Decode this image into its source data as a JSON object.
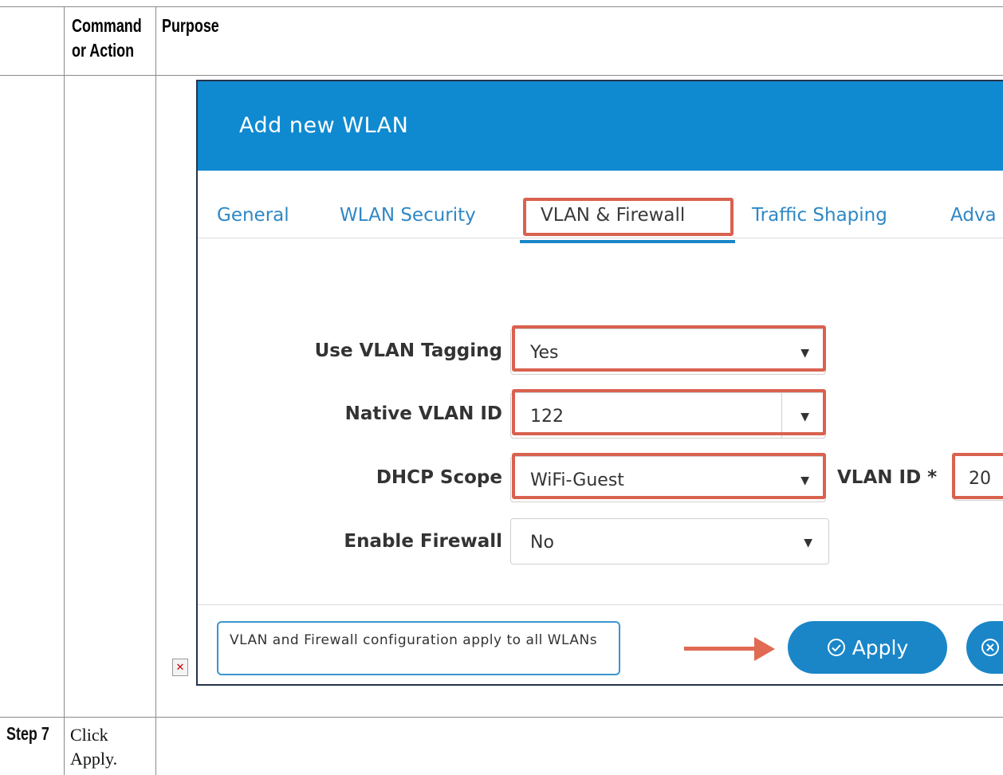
{
  "table": {
    "header_command": [
      "Command",
      "or Action"
    ],
    "header_purpose": "Purpose",
    "step_label": "Step 7",
    "step_text": [
      "Click",
      "Apply."
    ]
  },
  "dialog": {
    "title": "Add new WLAN",
    "tabs": [
      "General",
      "WLAN Security",
      "VLAN & Firewall",
      "Traffic Shaping",
      "Adva"
    ],
    "active_tab": "VLAN & Firewall",
    "fields": {
      "use_vlan_tagging": {
        "label": "Use VLAN Tagging",
        "value": "Yes"
      },
      "native_vlan_id": {
        "label": "Native VLAN ID",
        "value": "122"
      },
      "dhcp_scope": {
        "label": "DHCP Scope",
        "value": "WiFi-Guest"
      },
      "vlan_id": {
        "label": "VLAN ID *",
        "value": "20"
      },
      "enable_firewall": {
        "label": "Enable Firewall",
        "value": "No"
      }
    },
    "note": "VLAN and Firewall configuration apply to all WLANs",
    "apply_label": "Apply",
    "colors": {
      "header": "#0f8ad0",
      "highlight": "#d9624f",
      "accent": "#1a86c8"
    }
  },
  "icons": {
    "broken_image": "broken-image-icon",
    "apply": "check-circle-icon",
    "cancel": "close-circle-icon",
    "dropdown": "chevron-down-icon"
  }
}
